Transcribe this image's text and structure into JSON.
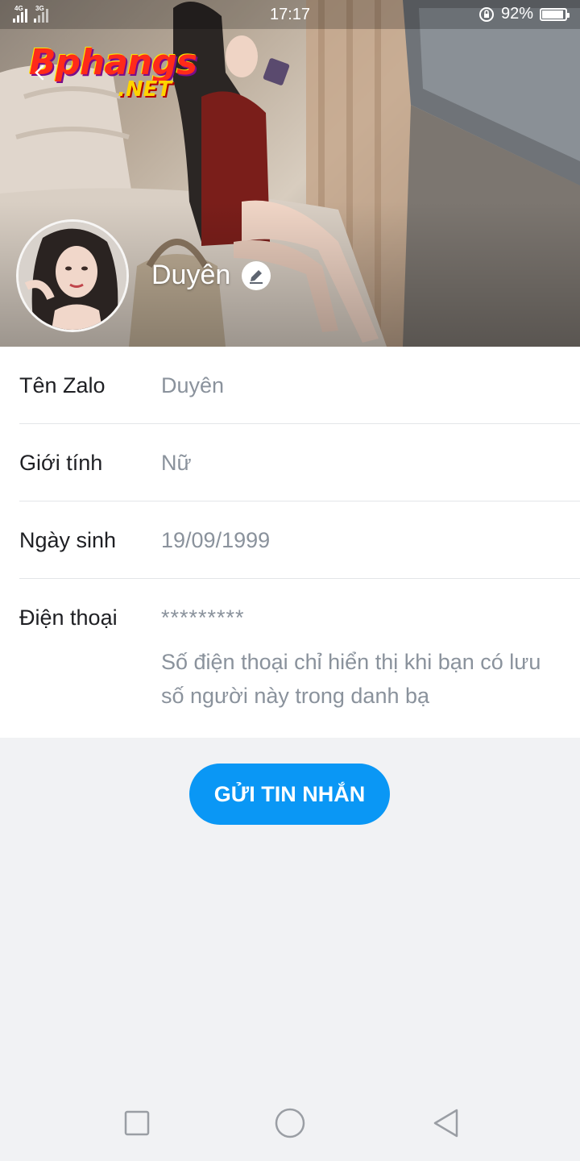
{
  "status_bar": {
    "network_1": "4G",
    "network_2": "3G",
    "time": "17:17",
    "battery_percent": "92%",
    "battery_level": 0.92
  },
  "watermark": {
    "text_main": "Bphangs",
    "text_suffix": ".NET"
  },
  "profile": {
    "name": "Duyên"
  },
  "info": {
    "rows": [
      {
        "label": "Tên Zalo",
        "value": "Duyên"
      },
      {
        "label": "Giới tính",
        "value": "Nữ"
      },
      {
        "label": "Ngày sinh",
        "value": "19/09/1999"
      },
      {
        "label": "Điện thoại",
        "value": "*********"
      }
    ],
    "phone_note": "Số điện thoại chỉ hiển thị khi bạn có lưu số người này trong danh bạ"
  },
  "actions": {
    "send_message_label": "GỬI TIN NHẮN"
  },
  "colors": {
    "accent": "#0a97f5",
    "label_text": "#1e1f23",
    "value_text": "#8a929c",
    "page_bg": "#f1f2f4"
  },
  "icons": {
    "back": "chevron-left-icon",
    "edit": "pencil-icon",
    "nav_recent": "square-icon",
    "nav_home": "circle-icon",
    "nav_back": "triangle-back-icon"
  }
}
